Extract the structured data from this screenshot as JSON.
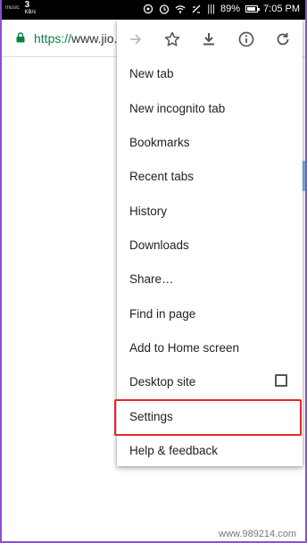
{
  "status_bar": {
    "music_label": "music",
    "speed_value": "3",
    "speed_unit": "KB/s",
    "signal_text": "|||",
    "battery_percent": "89%",
    "time": "7:05 PM"
  },
  "address_bar": {
    "url_scheme": "https://",
    "url_rest": "www.jio.c"
  },
  "menu": {
    "toolbar_icons": [
      "forward-arrow-icon",
      "star-icon",
      "download-icon",
      "info-icon",
      "refresh-icon"
    ],
    "items": [
      {
        "label": "New tab"
      },
      {
        "label": "New incognito tab"
      },
      {
        "label": "Bookmarks"
      },
      {
        "label": "Recent tabs"
      },
      {
        "label": "History"
      },
      {
        "label": "Downloads"
      },
      {
        "label": "Share…"
      },
      {
        "label": "Find in page"
      },
      {
        "label": "Add to Home screen"
      },
      {
        "label": "Desktop site"
      },
      {
        "label": "Settings"
      },
      {
        "label": "Help & feedback"
      }
    ],
    "desktop_site_checked": false,
    "highlight_color": "#e8262c"
  },
  "watermark": "www.989214.com",
  "colors": {
    "frame": "#8a4fd6",
    "scheme_green": "#0b8043"
  }
}
